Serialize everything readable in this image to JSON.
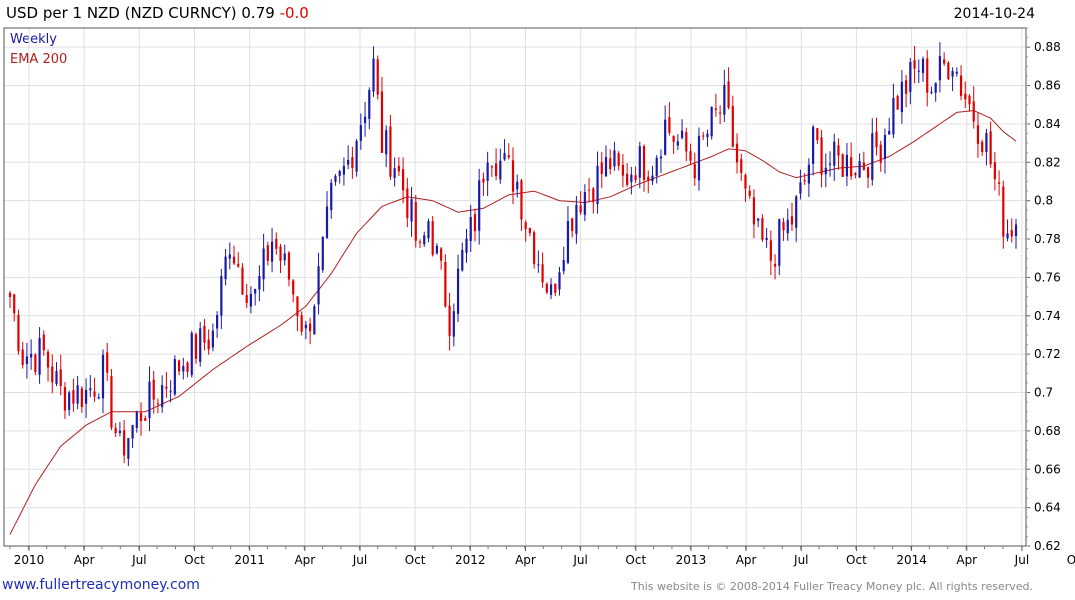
{
  "header": {
    "title": "USD per 1 NZD (NZD CURNCY) 0.79",
    "change": "-0.0",
    "date": "2014-10-24"
  },
  "legend": {
    "series": "Weekly",
    "ema": "EMA 200"
  },
  "footer": {
    "website": "www.fullertreacymoney.com",
    "copyright": "This website is © 2008-2014 Fuller Treacy Money plc. All rights reserved."
  },
  "colors": {
    "up": "#1a1aa8",
    "down": "#e00000",
    "ema": "#b02020",
    "grid": "#e0e0e0",
    "frame": "#555555"
  },
  "chart_data": {
    "type": "candlestick",
    "interval": "weekly",
    "y_range": [
      0.62,
      0.89
    ],
    "y_ticks": [
      "0.62",
      "0.64",
      "0.66",
      "0.68",
      "0.7",
      "0.72",
      "0.74",
      "0.76",
      "0.78",
      "0.8",
      "0.82",
      "0.84",
      "0.86",
      "0.88"
    ],
    "x_ticks": [
      "2010",
      "Apr",
      "Jul",
      "Oct",
      "2011",
      "Apr",
      "Jul",
      "Oct",
      "2012",
      "Apr",
      "Jul",
      "Oct",
      "2013",
      "Apr",
      "Jul",
      "Oct",
      "2014",
      "Apr",
      "Jul",
      "Oct"
    ],
    "close_anchors": [
      [
        0,
        0.75
      ],
      [
        3,
        0.72
      ],
      [
        8,
        0.72
      ],
      [
        12,
        0.7
      ],
      [
        18,
        0.7
      ],
      [
        22,
        0.71
      ],
      [
        24,
        0.69
      ],
      [
        26,
        0.67
      ],
      [
        31,
        0.69
      ],
      [
        35,
        0.7
      ],
      [
        42,
        0.72
      ],
      [
        48,
        0.73
      ],
      [
        52,
        0.78
      ],
      [
        55,
        0.76
      ],
      [
        58,
        0.75
      ],
      [
        62,
        0.78
      ],
      [
        66,
        0.76
      ],
      [
        70,
        0.73
      ],
      [
        73,
        0.76
      ],
      [
        76,
        0.8
      ],
      [
        80,
        0.82
      ],
      [
        84,
        0.85
      ],
      [
        86,
        0.87
      ],
      [
        88,
        0.83
      ],
      [
        91,
        0.82
      ],
      [
        94,
        0.8
      ],
      [
        97,
        0.77
      ],
      [
        99,
        0.79
      ],
      [
        102,
        0.76
      ],
      [
        104,
        0.74
      ],
      [
        107,
        0.77
      ],
      [
        110,
        0.79
      ],
      [
        113,
        0.83
      ],
      [
        116,
        0.82
      ],
      [
        120,
        0.81
      ],
      [
        122,
        0.79
      ],
      [
        125,
        0.77
      ],
      [
        128,
        0.75
      ],
      [
        131,
        0.78
      ],
      [
        134,
        0.8
      ],
      [
        138,
        0.81
      ],
      [
        142,
        0.82
      ],
      [
        145,
        0.81
      ],
      [
        148,
        0.82
      ],
      [
        152,
        0.82
      ],
      [
        155,
        0.84
      ],
      [
        158,
        0.83
      ],
      [
        162,
        0.82
      ],
      [
        166,
        0.84
      ],
      [
        169,
        0.85
      ],
      [
        171,
        0.83
      ],
      [
        174,
        0.8
      ],
      [
        177,
        0.78
      ],
      [
        180,
        0.77
      ],
      [
        182,
        0.78
      ],
      [
        185,
        0.79
      ],
      [
        188,
        0.81
      ],
      [
        190,
        0.83
      ],
      [
        193,
        0.82
      ],
      [
        196,
        0.82
      ],
      [
        199,
        0.82
      ],
      [
        202,
        0.82
      ],
      [
        206,
        0.83
      ],
      [
        209,
        0.85
      ],
      [
        212,
        0.86
      ],
      [
        215,
        0.87
      ],
      [
        218,
        0.86
      ],
      [
        221,
        0.87
      ],
      [
        223,
        0.875
      ],
      [
        225,
        0.86
      ],
      [
        227,
        0.85
      ],
      [
        229,
        0.84
      ],
      [
        231,
        0.83
      ],
      [
        233,
        0.81
      ],
      [
        235,
        0.79
      ],
      [
        236,
        0.785
      ],
      [
        238,
        0.79
      ]
    ],
    "ema_anchors": [
      [
        0,
        0.626
      ],
      [
        6,
        0.652
      ],
      [
        12,
        0.672
      ],
      [
        18,
        0.683
      ],
      [
        24,
        0.69
      ],
      [
        32,
        0.69
      ],
      [
        40,
        0.698
      ],
      [
        48,
        0.712
      ],
      [
        56,
        0.724
      ],
      [
        64,
        0.735
      ],
      [
        70,
        0.745
      ],
      [
        76,
        0.762
      ],
      [
        82,
        0.783
      ],
      [
        88,
        0.797
      ],
      [
        94,
        0.802
      ],
      [
        100,
        0.8
      ],
      [
        106,
        0.794
      ],
      [
        112,
        0.796
      ],
      [
        118,
        0.803
      ],
      [
        124,
        0.805
      ],
      [
        130,
        0.8
      ],
      [
        136,
        0.799
      ],
      [
        142,
        0.802
      ],
      [
        148,
        0.808
      ],
      [
        154,
        0.813
      ],
      [
        160,
        0.818
      ],
      [
        166,
        0.823
      ],
      [
        170,
        0.827
      ],
      [
        174,
        0.826
      ],
      [
        178,
        0.821
      ],
      [
        182,
        0.815
      ],
      [
        186,
        0.812
      ],
      [
        190,
        0.814
      ],
      [
        196,
        0.817
      ],
      [
        202,
        0.818
      ],
      [
        208,
        0.823
      ],
      [
        214,
        0.831
      ],
      [
        220,
        0.84
      ],
      [
        224,
        0.846
      ],
      [
        228,
        0.847
      ],
      [
        232,
        0.843
      ],
      [
        235,
        0.836
      ],
      [
        238,
        0.831
      ]
    ],
    "weeks": 239
  }
}
